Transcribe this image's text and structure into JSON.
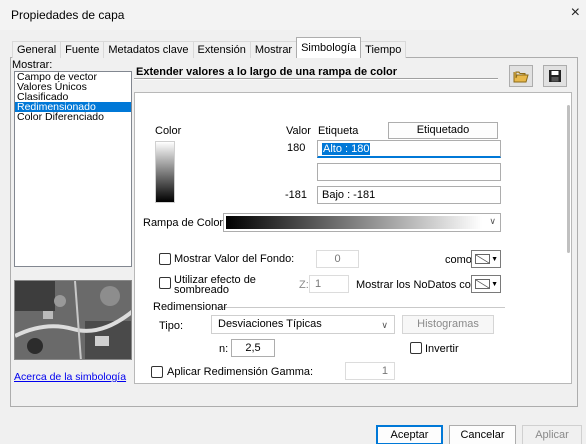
{
  "window": {
    "title": "Propiedades de capa",
    "close": "×"
  },
  "tabs": [
    {
      "label": "General"
    },
    {
      "label": "Fuente"
    },
    {
      "label": "Metadatos clave"
    },
    {
      "label": "Extensión"
    },
    {
      "label": "Mostrar"
    },
    {
      "label": "Simbología"
    },
    {
      "label": "Tiempo"
    }
  ],
  "sidebar": {
    "label": "Mostrar:",
    "items": [
      {
        "label": "Campo de vector"
      },
      {
        "label": "Valores Únicos"
      },
      {
        "label": "Clasificado"
      },
      {
        "label": "Redimensionado",
        "selected": true
      },
      {
        "label": "Color Diferenciado"
      }
    ],
    "about_link": "Acerca de la simbología"
  },
  "main": {
    "heading": "Extender valores a lo largo de una rampa de color",
    "icons": {
      "open": "open-folder-icon",
      "save": "save-disk-icon"
    },
    "color_header": "Color",
    "value_header": "Valor",
    "label_header": "Etiqueta",
    "label_button": "Etiquetado",
    "high_value": "180",
    "high_label_selected": "Alto : 180",
    "low_value": "-181",
    "low_label": "Bajo : -181",
    "ramp_label": "Rampa de Color:",
    "show_background_label": "Mostrar Valor del Fondo:",
    "background_value": "0",
    "como_label": "como",
    "hillshade_label_1": "Utilizar efecto de",
    "hillshade_label_2": "sombreado",
    "z_label": "Z:",
    "z_value": "1",
    "nodata_label": "Mostrar los NoDatos como",
    "stretch_group": "Redimensionar",
    "type_label": "Tipo:",
    "type_value": "Desviaciones Típicas",
    "histogram_button": "Histogramas",
    "n_label": "n:",
    "n_value": "2,5",
    "invert_label": "Invertir",
    "gamma_label": "Aplicar Redimensión Gamma:",
    "gamma_value": "1"
  },
  "footer": {
    "accept": "Aceptar",
    "cancel": "Cancelar",
    "apply": "Aplicar"
  },
  "colors": {
    "accent": "#0078d7",
    "link": "#0000ee"
  }
}
